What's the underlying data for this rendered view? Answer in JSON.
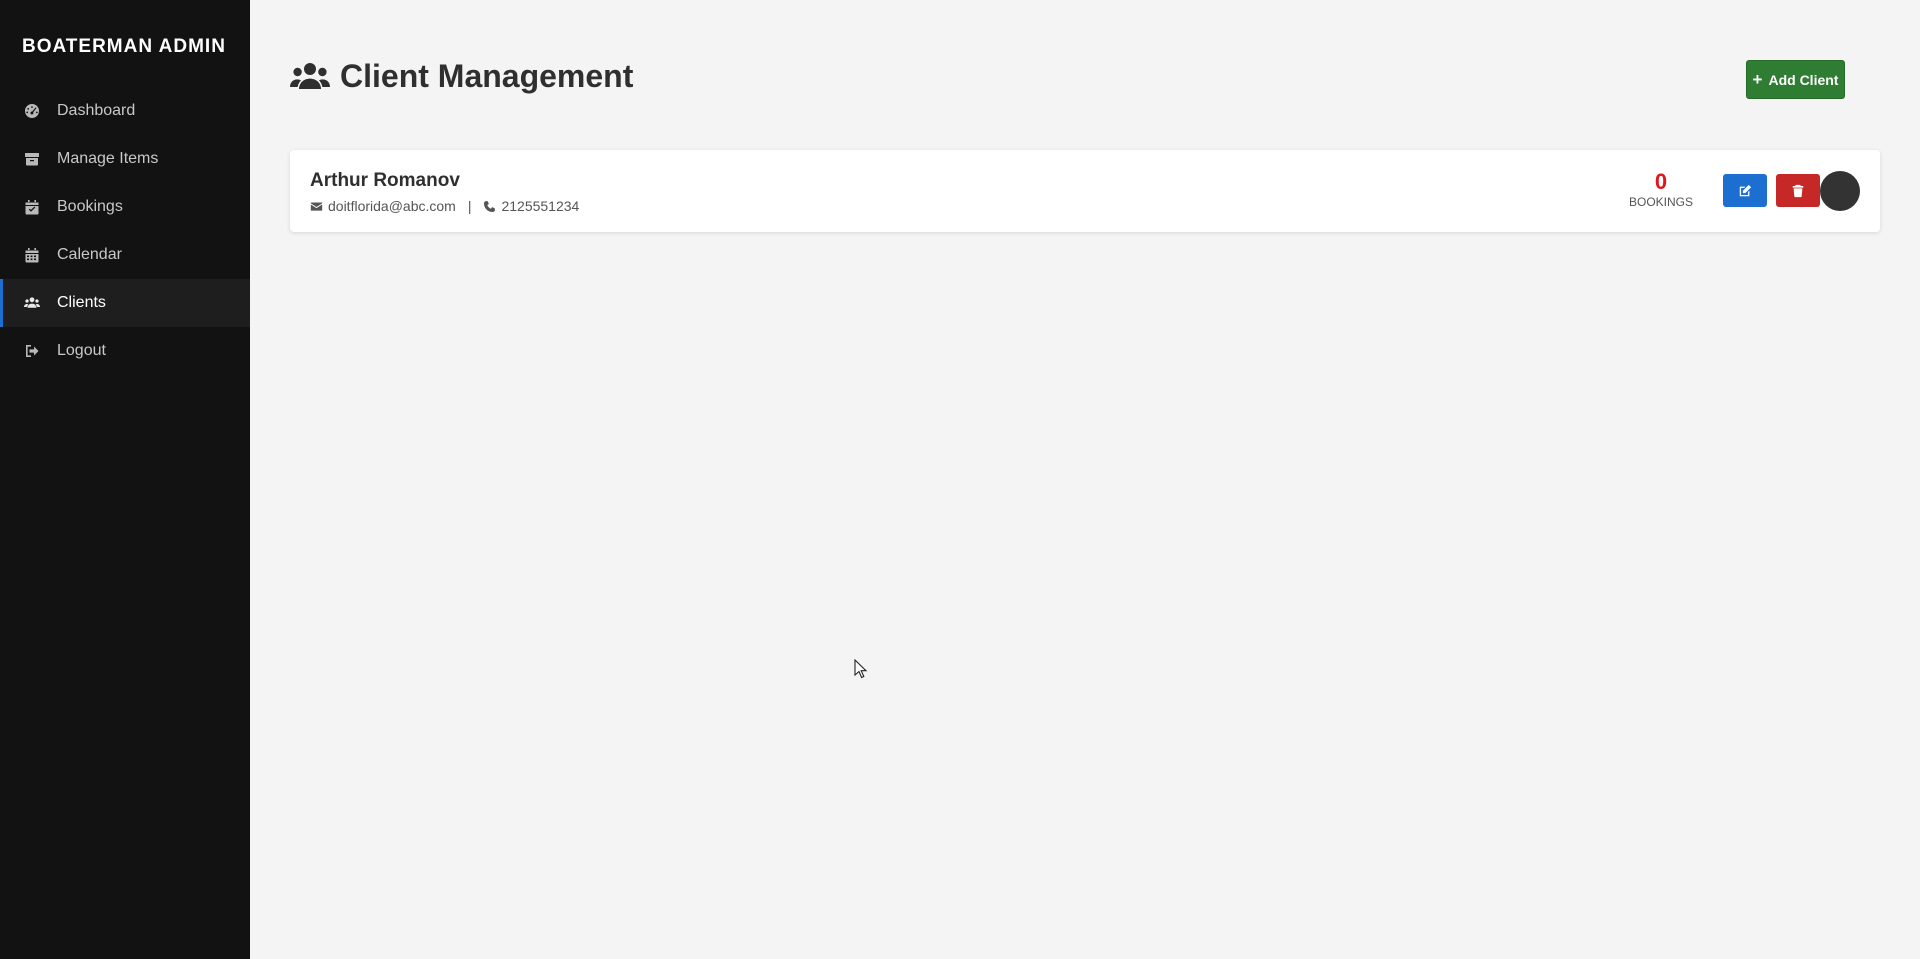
{
  "brand": "BOATERMAN ADMIN",
  "sidebar": {
    "items": [
      {
        "label": "Dashboard",
        "icon": "dashboard-gauge-icon"
      },
      {
        "label": "Manage Items",
        "icon": "box-icon"
      },
      {
        "label": "Bookings",
        "icon": "calendar-check-icon"
      },
      {
        "label": "Calendar",
        "icon": "calendar-icon"
      },
      {
        "label": "Clients",
        "icon": "users-icon",
        "active": true
      },
      {
        "label": "Logout",
        "icon": "logout-icon"
      }
    ]
  },
  "header": {
    "title": "Client Management",
    "add_button_label": "Add Client"
  },
  "clients": [
    {
      "name": "Arthur Romanov",
      "email": "doitflorida@abc.com",
      "separator": "|",
      "phone": "2125551234",
      "bookings_count": "0",
      "bookings_label": "BOOKINGS"
    }
  ],
  "colors": {
    "sidebar_bg": "#121212",
    "accent_blue": "#1c6fd1",
    "add_green": "#2e7d32",
    "delete_red": "#c62828",
    "count_red": "#e0161c"
  }
}
